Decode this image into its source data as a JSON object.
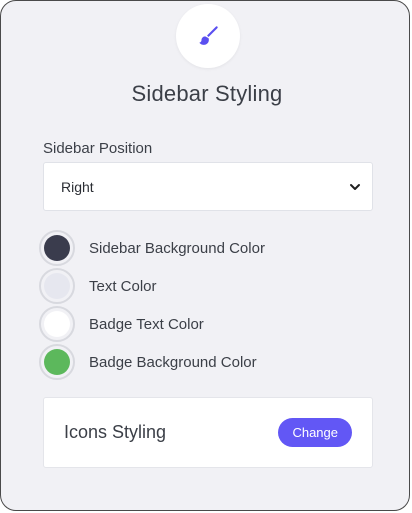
{
  "header": {
    "icon": "paintbrush-icon",
    "title": "Sidebar Styling"
  },
  "position": {
    "label": "Sidebar Position",
    "selected": "Right"
  },
  "colors": [
    {
      "label": "Sidebar Background Color",
      "value": "#3a3c4d"
    },
    {
      "label": "Text Color",
      "value": "#e6e7ef"
    },
    {
      "label": "Badge Text Color",
      "value": "#ffffff"
    },
    {
      "label": "Badge Background Color",
      "value": "#5cb85c"
    }
  ],
  "icons_card": {
    "title": "Icons Styling",
    "button_label": "Change"
  },
  "theme": {
    "accent": "#6257f5",
    "panel_bg": "#f1f1f5"
  }
}
